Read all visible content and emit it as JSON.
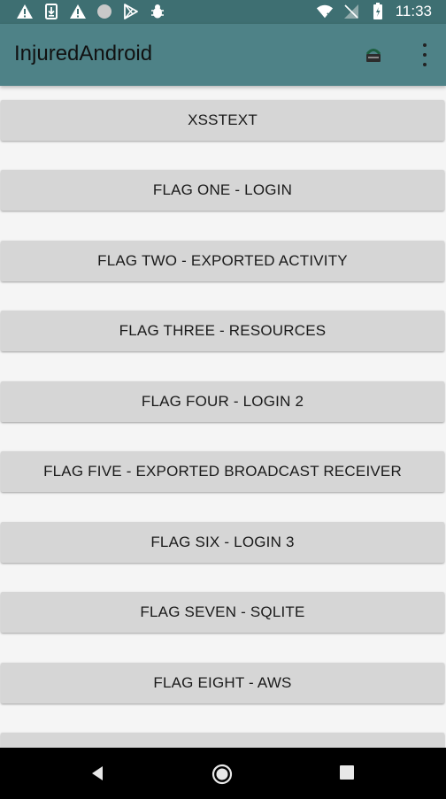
{
  "status_bar": {
    "time": "11:33",
    "left_icons": [
      "warning-icon",
      "download-icon",
      "warning-icon",
      "circle-icon",
      "play-store-icon",
      "bug-icon"
    ],
    "right_icons": [
      "wifi-icon",
      "no-sim-icon",
      "battery-charging-icon"
    ]
  },
  "app_bar": {
    "title": "InjuredAndroid",
    "icons": [
      "vpn-key-icon",
      "overflow-menu-icon"
    ],
    "color": "#4e8287"
  },
  "buttons": [
    "XSSTEXT",
    "FLAG ONE - LOGIN",
    "FLAG TWO - EXPORTED ACTIVITY",
    "FLAG THREE - RESOURCES",
    "FLAG FOUR - LOGIN 2",
    "FLAG FIVE - EXPORTED BROADCAST RECEIVER",
    "FLAG SIX - LOGIN 3",
    "FLAG SEVEN - SQLITE",
    "FLAG EIGHT - AWS",
    ""
  ],
  "nav_bar": {
    "icons": [
      "back-icon",
      "home-icon",
      "recents-icon"
    ]
  }
}
